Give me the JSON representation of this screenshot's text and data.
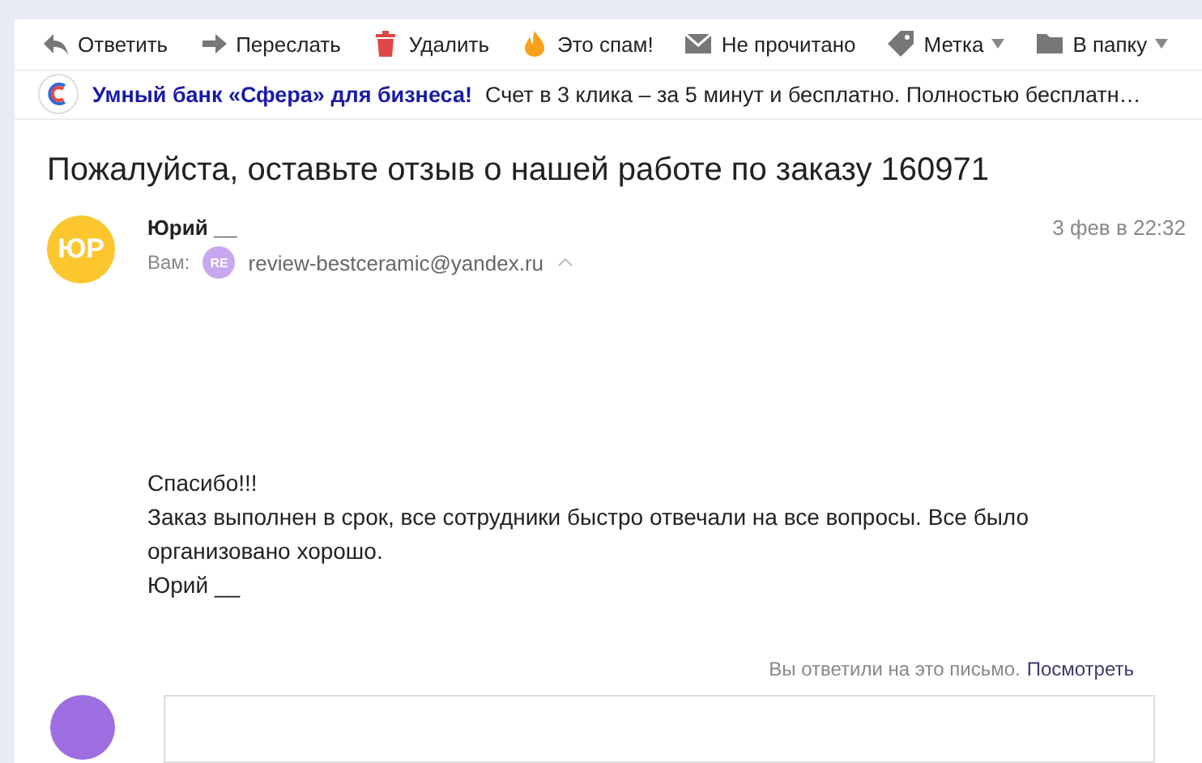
{
  "toolbar": [
    {
      "kind": "reply",
      "label": "Ответить",
      "dropdown": false
    },
    {
      "kind": "forward",
      "label": "Переслать",
      "dropdown": false
    },
    {
      "kind": "delete",
      "label": "Удалить",
      "dropdown": false
    },
    {
      "kind": "spam",
      "label": "Это спам!",
      "dropdown": false
    },
    {
      "kind": "unread",
      "label": "Не прочитано",
      "dropdown": false
    },
    {
      "kind": "label",
      "label": "Метка",
      "dropdown": true
    },
    {
      "kind": "folder",
      "label": "В папку",
      "dropdown": true
    }
  ],
  "ad": {
    "title": "Умный банк «Сфера» для бизнеса!",
    "text": "Счет в 3 клика – за 5 минут и бесплатно. Полностью бесплатн…"
  },
  "subject": "Пожалуйста, оставьте отзыв о нашей работе по заказу 160971",
  "message": {
    "avatar": "ЮР",
    "sender": "Юрий __",
    "date": "3 фев в 22:32",
    "to_label": "Вам:",
    "to_avatar": "RE",
    "to": "review-bestceramic@yandex.ru",
    "body": [
      "Спасибо!!!",
      "Заказ выполнен в срок, все сотрудники быстро отвечали на все вопросы. Все было организовано хорошо.",
      "Юрий __"
    ]
  },
  "replied": {
    "text": "Вы ответили на это письмо.",
    "link": "Посмотреть"
  }
}
